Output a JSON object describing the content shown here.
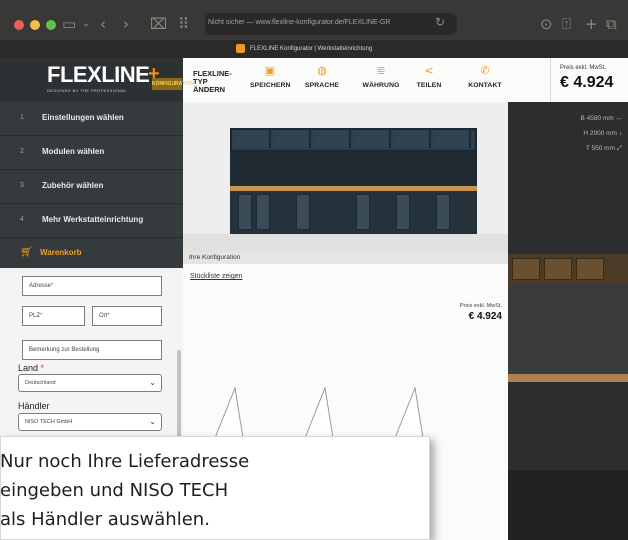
{
  "browser": {
    "url_text": "Nicht sicher — www.flexline-konfigurator.de/FLEXLINE-GR",
    "tab_title": "FLEXLINE Konfigurator | Werkstatteinrichtung"
  },
  "header": {
    "logo_text": "FLEXLINE",
    "logo_plus": "+",
    "logo_sub": "DESIGNED BY THE PROFESSIONAL",
    "logo_badge": "KONFIGURATION",
    "nav_title": "FLEXLINE-TYP ÄNDERN",
    "nav_items": [
      {
        "label": "SPEICHERN",
        "icon": "floppy-icon"
      },
      {
        "label": "SPRACHE",
        "icon": "globe-icon"
      },
      {
        "label": "WÄHRUNG",
        "icon": "coins-icon"
      },
      {
        "label": "TEILEN",
        "icon": "share-icon"
      },
      {
        "label": "KONTAKT",
        "icon": "phone-icon"
      }
    ],
    "price_label": "Preis exkl. MwSt.",
    "price_value": "€ 4.924"
  },
  "sidebar": {
    "steps": [
      {
        "num": "1",
        "label": "Einstellungen wählen"
      },
      {
        "num": "2",
        "label": "Modulen wählen"
      },
      {
        "num": "3",
        "label": "Zubehör wählen"
      },
      {
        "num": "4",
        "label": "Mehr Werkstatteinrichtung"
      }
    ],
    "cart_label": "Warenkorb"
  },
  "form": {
    "address_placeholder": "Adresse",
    "zip_placeholder": "PLZ",
    "city_placeholder": "Ort",
    "req_mark": "*",
    "remark_placeholder": "Bemerkung zur Bestellung",
    "country_label": "Land",
    "country_value": "Deutschland",
    "dealer_label": "Händler",
    "dealer_value": "NISO TECH GmbH"
  },
  "main": {
    "config_label": "Ihre Konfiguration",
    "parts_link": "Stückliste zeigen",
    "price_label": "Preis exkl. MwSt.",
    "price_value": "€ 4.924"
  },
  "dimensions": {
    "width": "B 4580 mm ↔",
    "height": "H 2000 mm ↕",
    "depth": "T 550 mm ⤢"
  },
  "callout": {
    "lines": [
      "Nur noch Ihre Lieferadresse",
      "eingeben und NISO TECH",
      "als Händler auswählen."
    ]
  },
  "colors": {
    "accent": "#f0a020",
    "sidebar": "#353a3d",
    "required": "#e0353a"
  }
}
